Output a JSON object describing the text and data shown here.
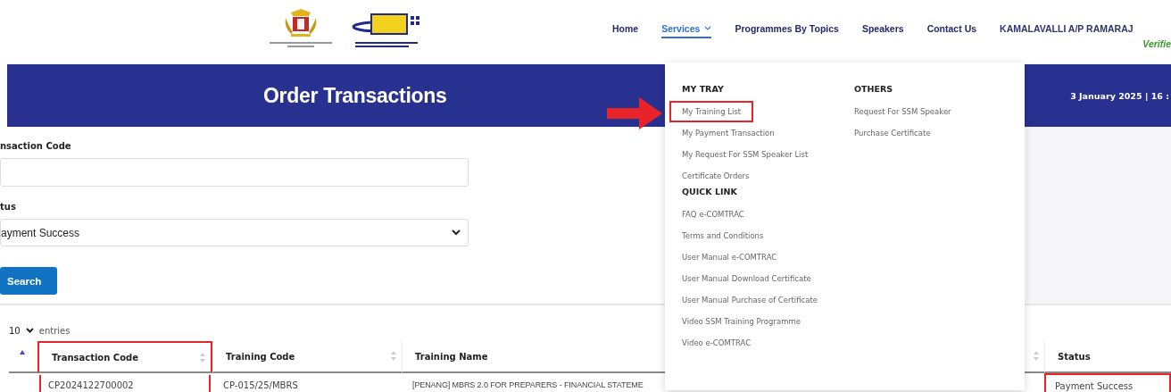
{
  "header": {
    "nav": [
      {
        "label": "Home",
        "selected": false,
        "kind": "link"
      },
      {
        "label": "Services",
        "selected": true,
        "kind": "dropdown"
      },
      {
        "label": "Programmes By Topics",
        "selected": false,
        "kind": "link"
      },
      {
        "label": "Speakers",
        "selected": false,
        "kind": "link"
      },
      {
        "label": "Contact Us",
        "selected": false,
        "kind": "link"
      }
    ],
    "user": {
      "name": "KAMALAVALLI A/P RAMARAJ",
      "status": "Verifie"
    }
  },
  "banner": {
    "title": "Order Transactions",
    "datetime": "3 January 2025 | 16 :"
  },
  "form": {
    "fields": [
      {
        "kind": "text",
        "label": "nsaction Code"
      },
      {
        "kind": "select",
        "label": "tus",
        "value": "ayment Success"
      }
    ],
    "button": "Search"
  },
  "table": {
    "page_size": "10",
    "entries_label": "entries",
    "columns": [
      {
        "sorted": true,
        "highlighted": false
      },
      {
        "label": "Transaction Code",
        "sorted": false,
        "highlighted": true
      },
      {
        "label": "Training Code",
        "sorted": false,
        "highlighted": false
      },
      {
        "label": "Training Name",
        "sorted": false,
        "highlighted": false
      },
      {
        "label": "Status",
        "highlighted": false
      }
    ],
    "rows": [
      {
        "cells": [
          "",
          "CP2024122700002",
          "CP-015/25/MBRS",
          "[PENANG] MBRS 2.0 FOR PREPARERS - FINANCIAL STATEME",
          "Payment Success"
        ],
        "status_highlighted": true
      }
    ]
  },
  "menu": {
    "columns": [
      {
        "sections": [
          {
            "heading": "MY TRAY",
            "items": [
              {
                "label": "My Training List",
                "highlighted": true
              },
              {
                "label": "My Payment Transaction",
                "highlighted": false
              },
              {
                "label": "My Request For SSM Speaker List",
                "highlighted": false
              },
              {
                "label": "Certificate Orders",
                "highlighted": false
              }
            ]
          },
          {
            "heading": "QUICK LINK",
            "items": [
              {
                "label": "FAQ e-COMTRAC",
                "highlighted": false
              },
              {
                "label": "Terms and Conditions",
                "highlighted": false
              },
              {
                "label": "User Manual e-COMTRAC",
                "highlighted": false
              },
              {
                "label": "User Manual Download Certificate",
                "highlighted": false
              },
              {
                "label": "User Manual Purchase of Certificate",
                "highlighted": false
              },
              {
                "label": "Video SSM Training Programme",
                "highlighted": false
              },
              {
                "label": "Video e-COMTRAC",
                "highlighted": false
              }
            ]
          }
        ]
      },
      {
        "sections": [
          {
            "heading": "OTHERS",
            "items": [
              {
                "label": "Request For SSM Speaker",
                "highlighted": false
              },
              {
                "label": "Purchase Certificate",
                "highlighted": false
              }
            ]
          }
        ]
      }
    ]
  }
}
